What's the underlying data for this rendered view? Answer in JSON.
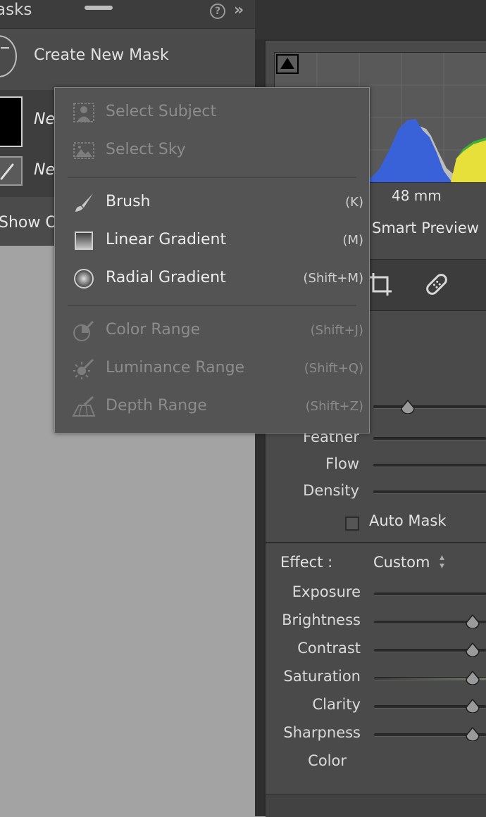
{
  "masks_panel": {
    "title": "asks",
    "help_glyph": "?",
    "collapse_glyph": "»",
    "create_label": "Create New Mask",
    "mask_items": [
      {
        "name": "Ne"
      },
      {
        "name": "Ne"
      }
    ],
    "show_overlay_label": "Show O"
  },
  "menu": {
    "groups": [
      [
        {
          "label": "Select Subject",
          "shortcut": "",
          "icon": "select-subject-icon",
          "enabled": false
        },
        {
          "label": "Select Sky",
          "shortcut": "",
          "icon": "select-sky-icon",
          "enabled": false
        }
      ],
      [
        {
          "label": "Brush",
          "shortcut": "(K)",
          "icon": "brush-icon",
          "enabled": true
        },
        {
          "label": "Linear Gradient",
          "shortcut": "(M)",
          "icon": "linear-gradient-icon",
          "enabled": true
        },
        {
          "label": "Radial Gradient",
          "shortcut": "(Shift+M)",
          "icon": "radial-gradient-icon",
          "enabled": true
        }
      ],
      [
        {
          "label": "Color Range",
          "shortcut": "(Shift+J)",
          "icon": "color-range-icon",
          "enabled": false
        },
        {
          "label": "Luminance Range",
          "shortcut": "(Shift+Q)",
          "icon": "luminance-range-icon",
          "enabled": false
        },
        {
          "label": "Depth Range",
          "shortcut": "(Shift+Z)",
          "icon": "depth-range-icon",
          "enabled": false
        }
      ]
    ]
  },
  "histogram": {
    "focal_length": "48 mm",
    "preview_label": "Smart Preview",
    "colors": {
      "blue": "#3a62d8",
      "yellow": "#e8e03a",
      "green": "#3fae3f",
      "gray": "#bdbdbd"
    }
  },
  "brush_settings": {
    "sliders": [
      {
        "label": "",
        "value": 0.2
      },
      {
        "label": "Feather",
        "value": null
      },
      {
        "label": "Flow",
        "value": null
      },
      {
        "label": "Density",
        "value": null
      }
    ],
    "auto_mask_label": "Auto Mask",
    "auto_mask_checked": false
  },
  "effect": {
    "label": "Effect :",
    "preset": "Custom",
    "sliders": [
      {
        "label": "Exposure",
        "value": null
      },
      {
        "label": "Brightness",
        "value": 0.5
      },
      {
        "label": "Contrast",
        "value": 0.5
      },
      {
        "label": "Saturation",
        "value": 0.5
      },
      {
        "label": "Clarity",
        "value": 0.5
      },
      {
        "label": "Sharpness",
        "value": 0.5
      }
    ],
    "color_label": "Color"
  }
}
